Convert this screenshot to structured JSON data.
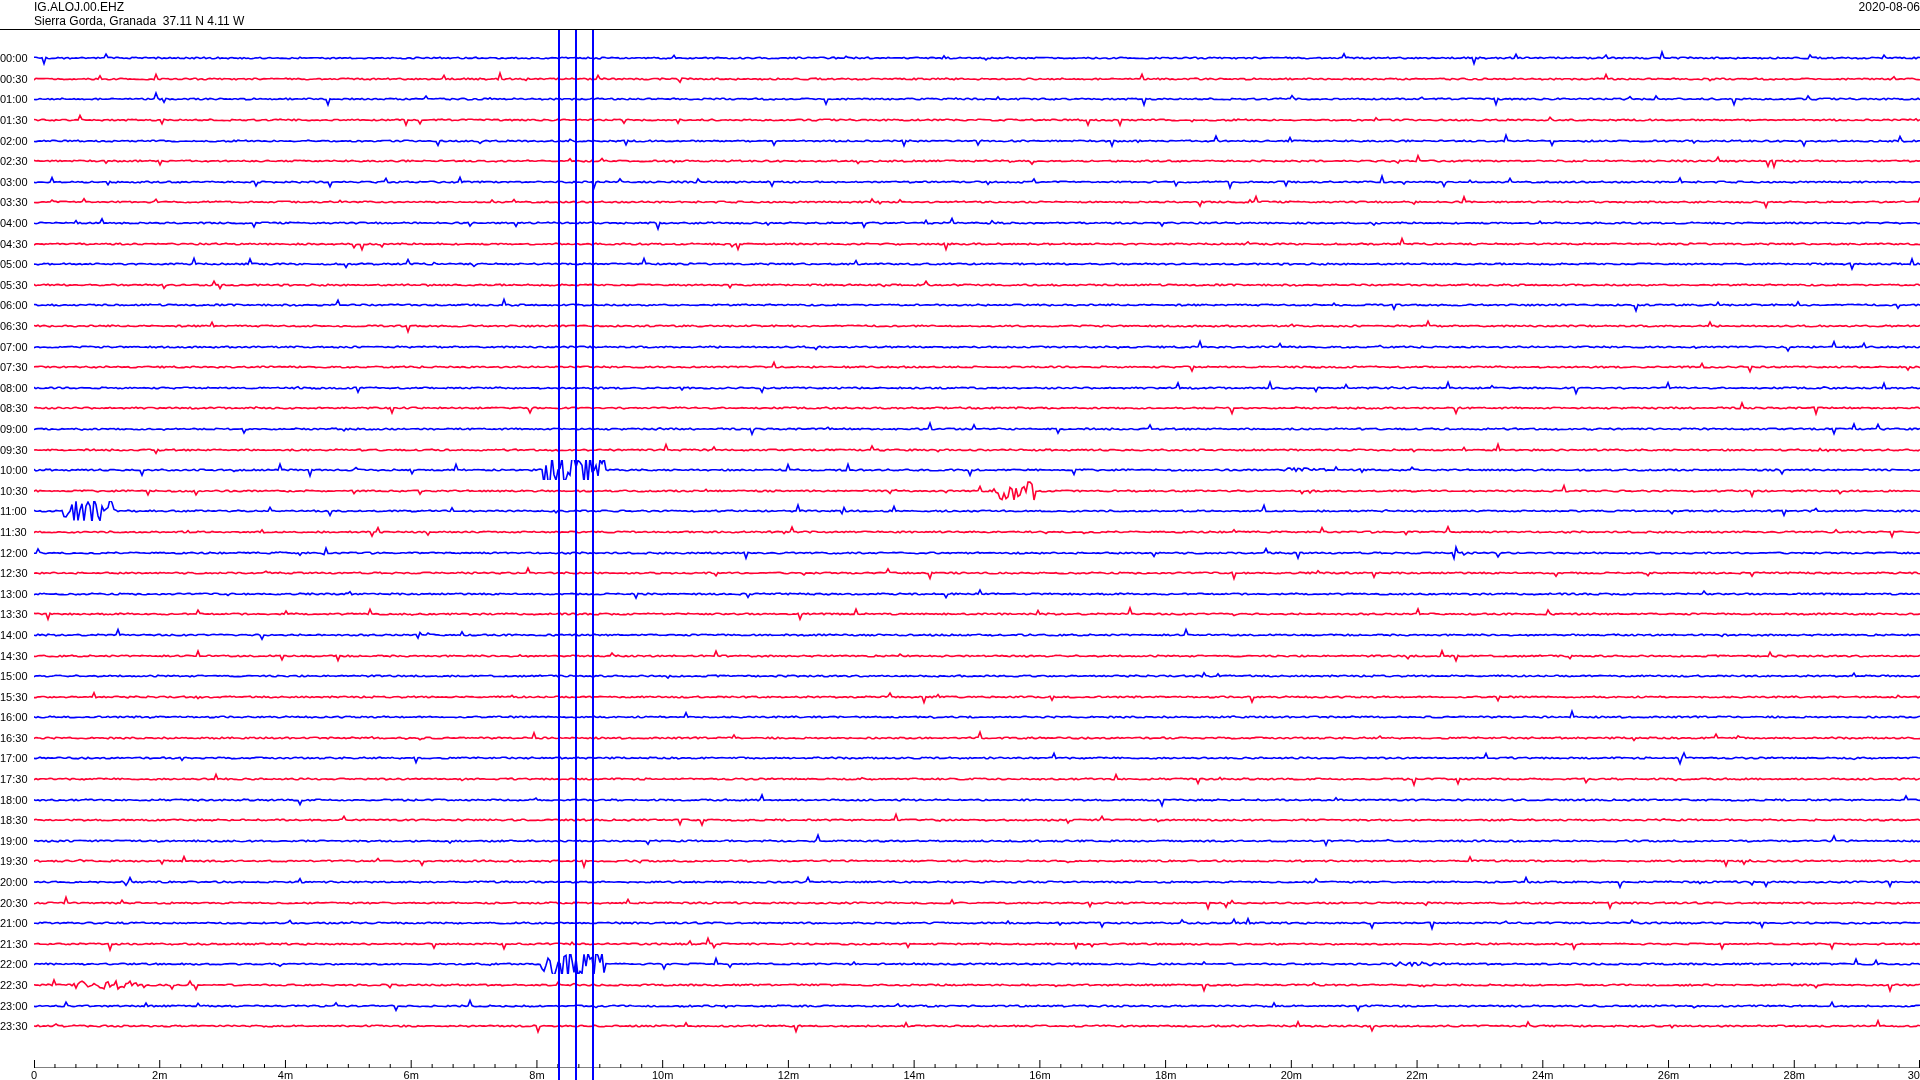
{
  "header": {
    "station": "IG.ALOJ.00.EHZ",
    "location": "Sierra Gorda, Granada  37.11 N 4.11 W",
    "date": "2020-08-06"
  },
  "rows": [
    {
      "time": "00:00",
      "color": "#0000ff"
    },
    {
      "time": "00:30",
      "color": "#ff0033"
    },
    {
      "time": "01:00",
      "color": "#0000ff"
    },
    {
      "time": "01:30",
      "color": "#ff0033"
    },
    {
      "time": "02:00",
      "color": "#0000ff"
    },
    {
      "time": "02:30",
      "color": "#ff0033"
    },
    {
      "time": "03:00",
      "color": "#0000ff"
    },
    {
      "time": "03:30",
      "color": "#ff0033"
    },
    {
      "time": "04:00",
      "color": "#0000ff"
    },
    {
      "time": "04:30",
      "color": "#ff0033"
    },
    {
      "time": "05:00",
      "color": "#0000ff"
    },
    {
      "time": "05:30",
      "color": "#ff0033"
    },
    {
      "time": "06:00",
      "color": "#0000ff"
    },
    {
      "time": "06:30",
      "color": "#ff0033"
    },
    {
      "time": "07:00",
      "color": "#0000ff"
    },
    {
      "time": "07:30",
      "color": "#ff0033"
    },
    {
      "time": "08:00",
      "color": "#0000ff"
    },
    {
      "time": "08:30",
      "color": "#ff0033"
    },
    {
      "time": "09:00",
      "color": "#0000ff"
    },
    {
      "time": "09:30",
      "color": "#ff0033"
    },
    {
      "time": "10:00",
      "color": "#0000ff"
    },
    {
      "time": "10:30",
      "color": "#ff0033"
    },
    {
      "time": "11:00",
      "color": "#0000ff"
    },
    {
      "time": "11:30",
      "color": "#ff0033"
    },
    {
      "time": "12:00",
      "color": "#0000ff"
    },
    {
      "time": "12:30",
      "color": "#ff0033"
    },
    {
      "time": "13:00",
      "color": "#0000ff"
    },
    {
      "time": "13:30",
      "color": "#ff0033"
    },
    {
      "time": "14:00",
      "color": "#0000ff"
    },
    {
      "time": "14:30",
      "color": "#ff0033"
    },
    {
      "time": "15:00",
      "color": "#0000ff"
    },
    {
      "time": "15:30",
      "color": "#ff0033"
    },
    {
      "time": "16:00",
      "color": "#0000ff"
    },
    {
      "time": "16:30",
      "color": "#ff0033"
    },
    {
      "time": "17:00",
      "color": "#0000ff"
    },
    {
      "time": "17:30",
      "color": "#ff0033"
    },
    {
      "time": "18:00",
      "color": "#0000ff"
    },
    {
      "time": "18:30",
      "color": "#ff0033"
    },
    {
      "time": "19:00",
      "color": "#0000ff"
    },
    {
      "time": "19:30",
      "color": "#ff0033"
    },
    {
      "time": "20:00",
      "color": "#0000ff"
    },
    {
      "time": "20:30",
      "color": "#ff0033"
    },
    {
      "time": "21:00",
      "color": "#0000ff"
    },
    {
      "time": "21:30",
      "color": "#ff0033"
    },
    {
      "time": "22:00",
      "color": "#0000ff"
    },
    {
      "time": "22:30",
      "color": "#ff0033"
    },
    {
      "time": "23:00",
      "color": "#0000ff"
    },
    {
      "time": "23:30",
      "color": "#ff0033"
    }
  ],
  "x_axis": {
    "ticks": [
      "0",
      "2m",
      "4m",
      "6m",
      "8m",
      "10m",
      "12m",
      "14m",
      "16m",
      "18m",
      "20m",
      "22m",
      "24m",
      "26m",
      "28m",
      "30"
    ]
  }
}
